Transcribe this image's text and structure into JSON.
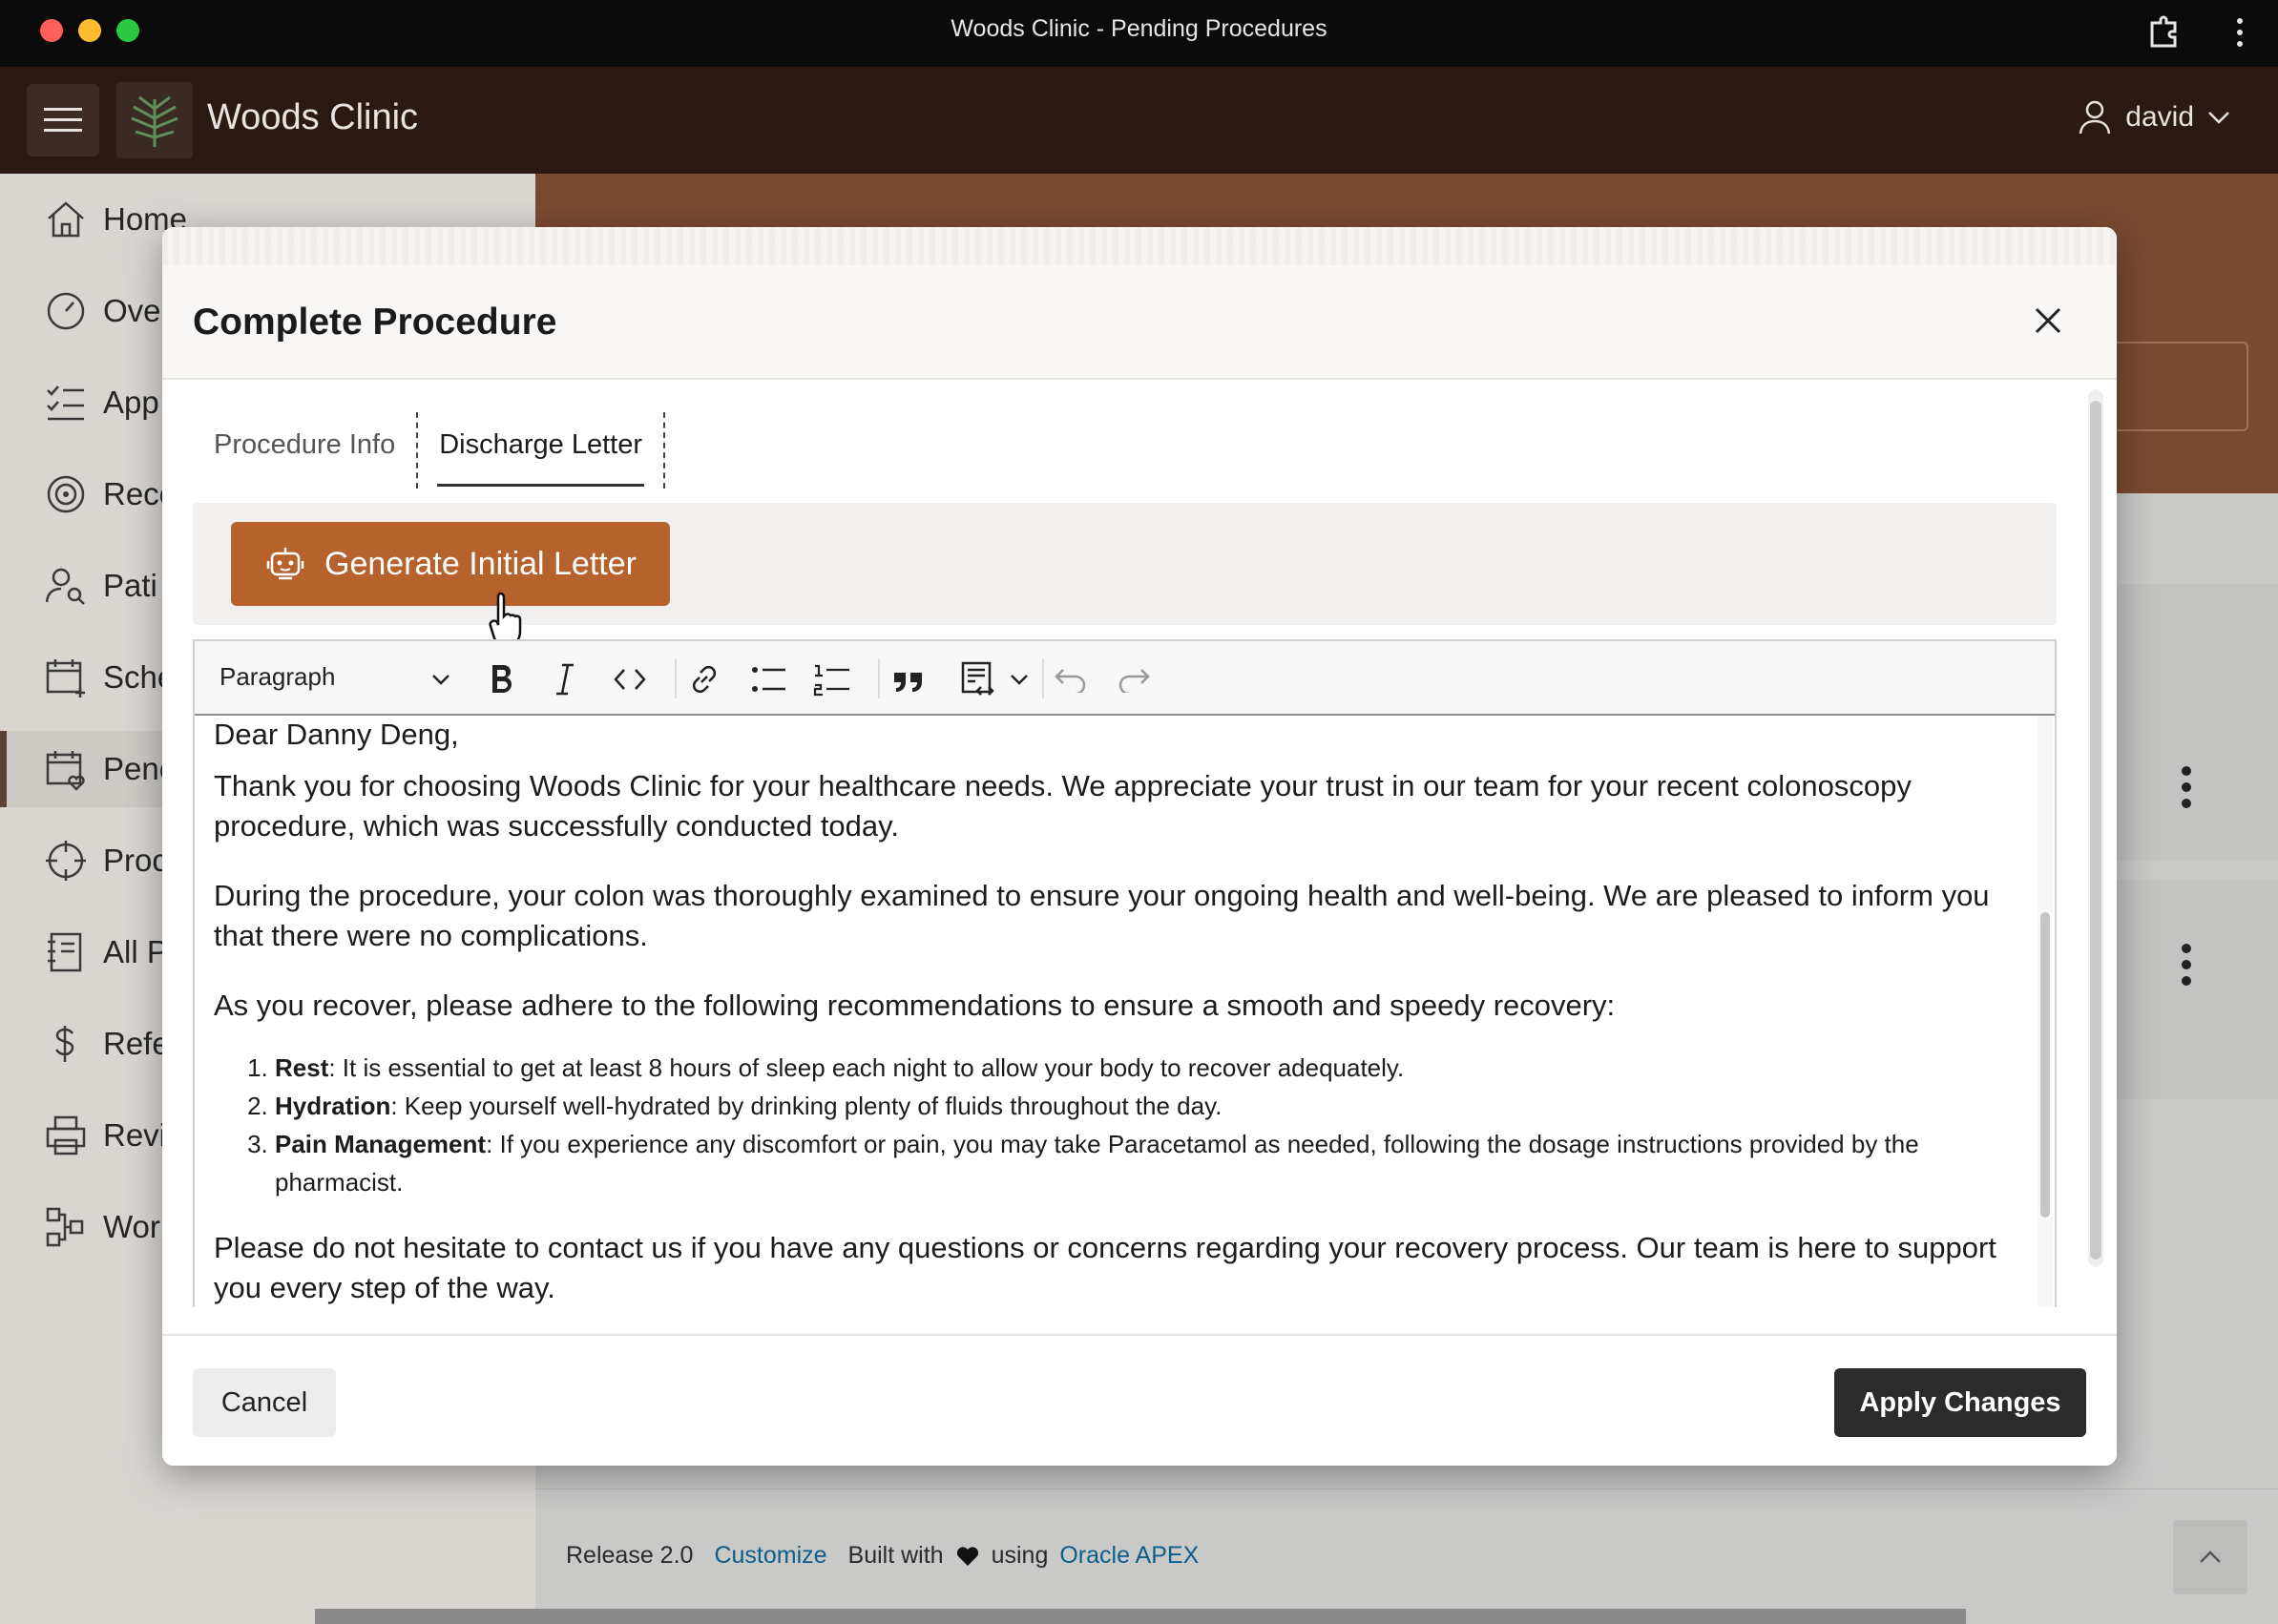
{
  "window": {
    "title": "Woods Clinic - Pending Procedures"
  },
  "header": {
    "app_name": "Woods Clinic",
    "user": "david"
  },
  "sidebar": {
    "items": [
      {
        "label": "Home",
        "icon": "home-icon"
      },
      {
        "label": "Ove",
        "icon": "gauge-icon"
      },
      {
        "label": "App",
        "icon": "checklist-icon"
      },
      {
        "label": "Rece",
        "icon": "target-icon"
      },
      {
        "label": "Pati",
        "icon": "user-search-icon"
      },
      {
        "label": "Sche",
        "icon": "calendar-add-icon"
      },
      {
        "label": "Penc",
        "icon": "calendar-heart-icon"
      },
      {
        "label": "Proc",
        "icon": "crosshair-icon"
      },
      {
        "label": "All P",
        "icon": "notebook-icon"
      },
      {
        "label": "Refe",
        "icon": "dollar-icon"
      },
      {
        "label": "Revi",
        "icon": "printer-icon"
      },
      {
        "label": "Wor",
        "icon": "workflow-icon"
      }
    ],
    "active_index": 6
  },
  "modal": {
    "title": "Complete Procedure",
    "tabs": [
      {
        "label": "Procedure Info"
      },
      {
        "label": "Discharge Letter"
      }
    ],
    "generate_button": "Generate Initial Letter",
    "editor": {
      "block_format": "Paragraph",
      "toolbar_icons": [
        "bold-icon",
        "italic-icon",
        "code-icon",
        "link-icon",
        "bullet-list-icon",
        "numbered-list-icon",
        "blockquote-icon",
        "source-icon",
        "undo-icon",
        "redo-icon"
      ],
      "greeting": "Dear Danny Deng,",
      "para1": "Thank you for choosing Woods Clinic for your healthcare needs. We appreciate your trust in our team for your recent colonoscopy procedure, which was successfully conducted today.",
      "para2": "During the procedure, your colon was thoroughly examined to ensure your ongoing health and well-being. We are pleased to inform you that there were no complications.",
      "para3": "As you recover, please adhere to the following recommendations to ensure a smooth and speedy recovery:",
      "list": [
        {
          "term": "Rest",
          "text": ": It is essential to get at least 8 hours of sleep each night to allow your body to recover adequately."
        },
        {
          "term": "Hydration",
          "text": ": Keep yourself well-hydrated by drinking plenty of fluids throughout the day."
        },
        {
          "term": "Pain Management",
          "text": ": If you experience any discomfort or pain, you may take Paracetamol as needed, following the dosage instructions provided by the pharmacist."
        }
      ],
      "para4": "Please do not hesitate to contact us if you have any questions or concerns regarding your recovery process. Our team is here to support you every step of the way."
    },
    "cancel_label": "Cancel",
    "apply_label": "Apply Changes"
  },
  "footer": {
    "release": "Release 2.0",
    "customize": "Customize",
    "built_with": "Built with",
    "using": "using",
    "apex_link": "Oracle APEX"
  },
  "colors": {
    "brand": "#b5622c",
    "header": "#2b1912",
    "primary_button": "#2b2b2b"
  }
}
